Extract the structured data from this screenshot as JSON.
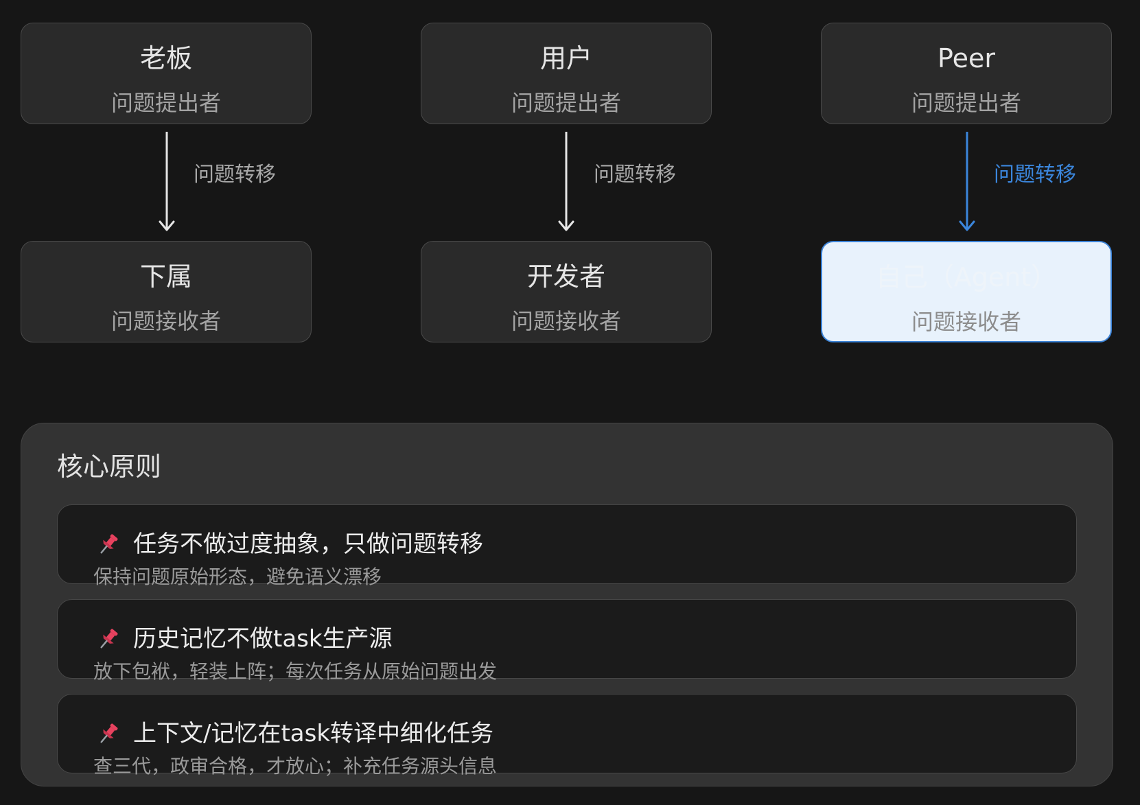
{
  "columns": [
    {
      "top": {
        "title": "老板",
        "subtitle": "问题提出者"
      },
      "edge_label": "问题转移",
      "bottom": {
        "title": "下属",
        "subtitle": "问题接收者"
      }
    },
    {
      "top": {
        "title": "用户",
        "subtitle": "问题提出者"
      },
      "edge_label": "问题转移",
      "bottom": {
        "title": "开发者",
        "subtitle": "问题接收者"
      }
    },
    {
      "top": {
        "title": "Peer",
        "subtitle": "问题提出者"
      },
      "edge_label": "问题转移",
      "bottom": {
        "title": "自己（Agent）",
        "subtitle": "问题接收者"
      }
    }
  ],
  "principles": {
    "title": "核心原则",
    "icon": "pushpin-icon",
    "items": [
      {
        "title": "任务不做过度抽象，只做问题转移",
        "desc": "保持问题原始形态，避免语义漂移"
      },
      {
        "title": "历史记忆不做task生产源",
        "desc": "放下包袱，轻装上阵；每次任务从原始问题出发"
      },
      {
        "title": "上下文/记忆在task转译中细化任务",
        "desc": "查三代，政审合格，才放心；补充任务源头信息"
      }
    ]
  },
  "colors": {
    "background": "#161616",
    "node_fill": "#2a2a2a",
    "node_border": "#4a4a4a",
    "highlight_fill": "#e8f2fc",
    "accent_blue": "#3b86dc",
    "arrow_default": "#e6e6e6",
    "panel_fill": "#333333",
    "pin_red": "#e8425f"
  }
}
